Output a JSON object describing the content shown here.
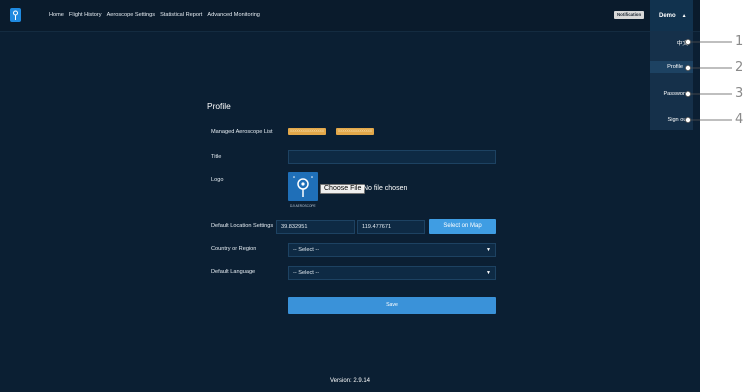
{
  "nav": {
    "items": [
      "Home",
      "Flight History",
      "Aeroscope Settings",
      "Statistical Report",
      "Advanced Monitoring"
    ]
  },
  "header": {
    "notification_label": "Notification",
    "user_name": "Demo",
    "user_caret": "▲"
  },
  "user_menu": {
    "items": [
      "中文",
      "Profile",
      "Password",
      "Sign out"
    ],
    "active": "Profile"
  },
  "callouts": [
    "1",
    "2",
    "3",
    "4"
  ],
  "form": {
    "title": "Profile",
    "managed_list_label": "Managed Aeroscope List",
    "managed_list_badges": [
      "XXXXXXXXXXXXXXXX",
      "XXXXXXXXXXXXXXXX"
    ],
    "title_label": "Title",
    "title_value": "",
    "logo_label": "Logo",
    "logo_caption": "DJI AEROSCOPE",
    "file_button": "Choose File",
    "file_status": "No file chosen",
    "location_label": "Default Location Settings",
    "latitude": "39.832951",
    "longitude": "119.477671",
    "map_button": "Select on Map",
    "country_label": "Country or Region",
    "country_value": "-- Select --",
    "language_label": "Default Language",
    "language_value": "-- Select --",
    "save_button": "Save"
  },
  "footer": {
    "version": "Version: 2.9.14"
  },
  "colors": {
    "background": "#0b1f33",
    "accent": "#3a92d9",
    "badge": "#e3a84a"
  }
}
